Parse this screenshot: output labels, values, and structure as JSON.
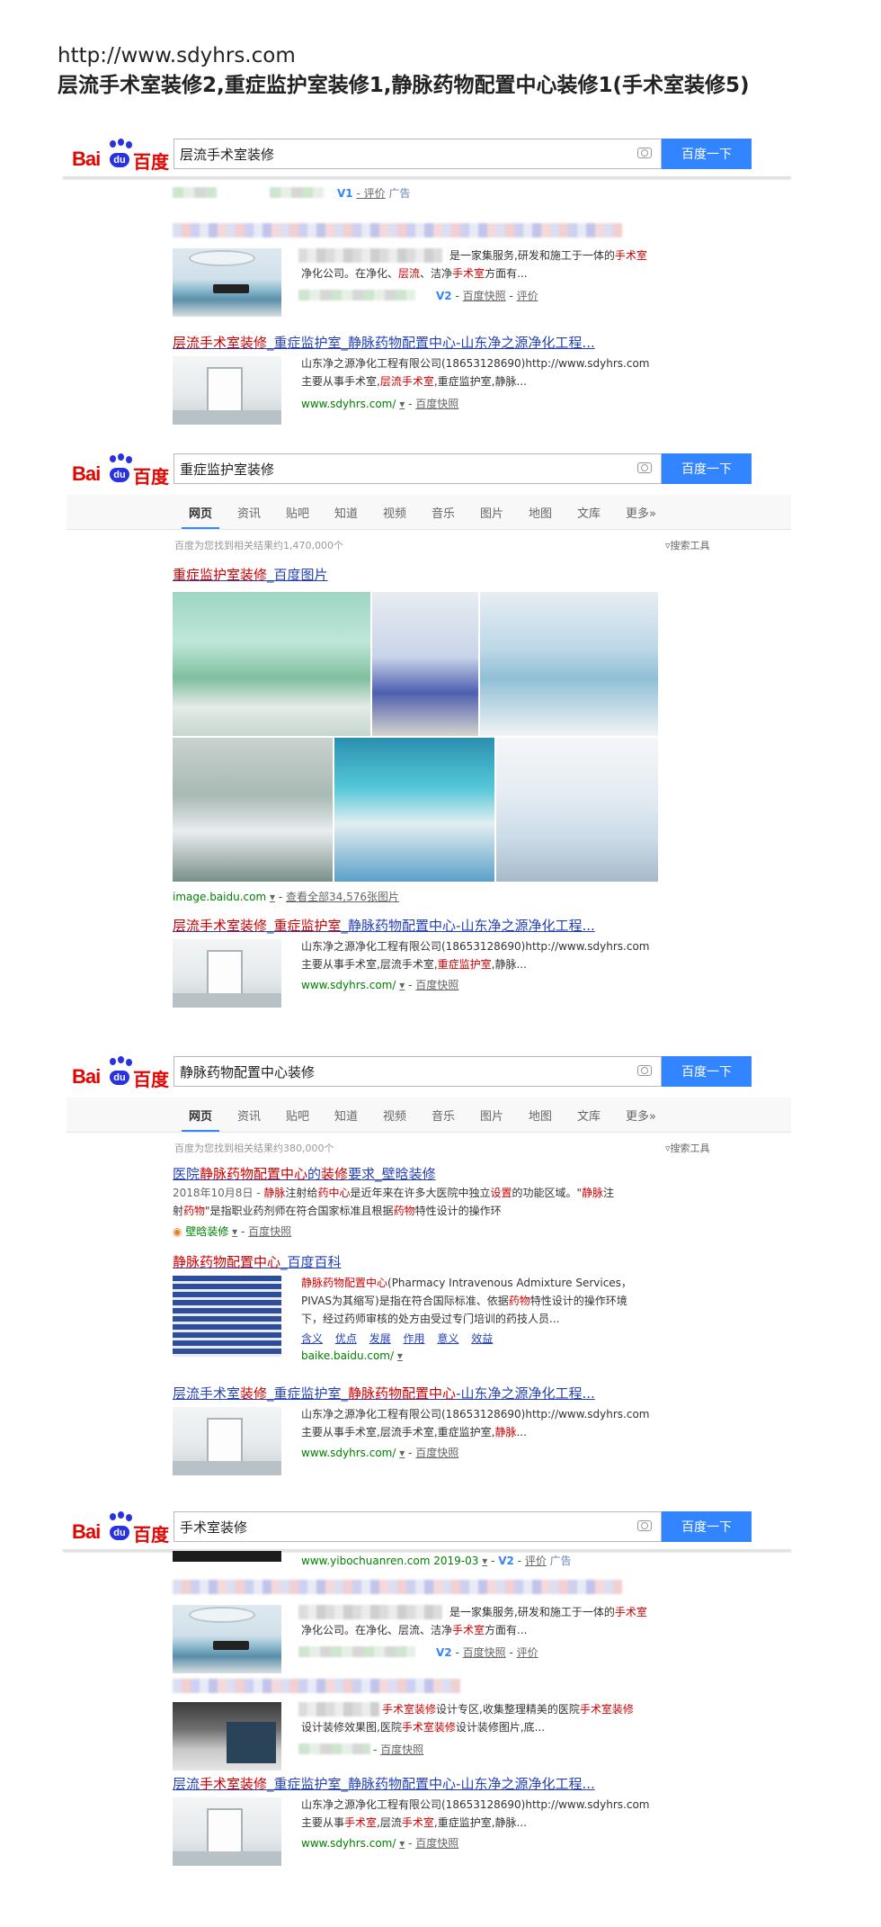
{
  "header": {
    "url": "http://www.sdyhrs.com",
    "title": "层流手术室装修2,重症监护室装修1,静脉药物配置中心装修1(手术室装修5)"
  },
  "common": {
    "logo_bai": "Bai",
    "logo_du": "du",
    "logo_cn": "百度",
    "search_button": "百度一下",
    "colors": {
      "accent": "#3385ff",
      "link": "#2440b3",
      "highlight": "#cc0000",
      "green": "#008000",
      "logo_red": "#e10601"
    }
  },
  "tabs": [
    "网页",
    "资讯",
    "贴吧",
    "知道",
    "视频",
    "音乐",
    "图片",
    "地图",
    "文库",
    "更多»"
  ],
  "search_tools": "搜索工具",
  "panel1": {
    "query": "层流手术室装修",
    "ad_links": {
      "rating": "评价",
      "ad": "广告",
      "v": "V1"
    },
    "r2": {
      "snip1": "是一家集服务,研发和施工于一体的",
      "snip1_em": "手术室",
      "snip2a": "净化公司。在净化、",
      "snip2_em1": "层流",
      "snip2b": "、洁净",
      "snip2_em2": "手术室",
      "snip2c": "方面有...",
      "v": "V2",
      "kuaizhao": "百度快照",
      "rating": "评价"
    },
    "r3": {
      "title_em1": "层流手术室装修",
      "title_mid": "_重症监护室_静脉药物配置中心-山东净之源净化工程...",
      "line1": "山东净之源净化工程有限公司(18653128690)http://www.sdyhrs.com",
      "line2a": "主要从事手术室,",
      "line2_em": "层流手术室",
      "line2b": ",重症监护室,静脉...",
      "url": "www.sdyhrs.com/",
      "kuaizhao": "百度快照"
    }
  },
  "panel2": {
    "query": "重症监护室装修",
    "stats": "百度为您找到相关结果约1,470,000个",
    "img_title_em": "重症监护室装修",
    "img_title_rest": "_百度图片",
    "img_source": "image.baidu.com",
    "img_all": "查看全部34,576张图片",
    "r2": {
      "title_em1": "层流手术室装修",
      "title_mid": "_",
      "title_em2": "重症监护室",
      "title_rest": "_静脉药物配置中心-山东净之源净化工程...",
      "line1": "山东净之源净化工程有限公司(18653128690)http://www.sdyhrs.com",
      "line2a": "主要从事手术室,层流手术室,",
      "line2_em": "重症监护室",
      "line2b": ",静脉...",
      "url": "www.sdyhrs.com/",
      "kuaizhao": "百度快照"
    }
  },
  "panel3": {
    "query": "静脉药物配置中心装修",
    "stats": "百度为您找到相关结果约380,000个",
    "r1": {
      "title_a": "医院",
      "title_em1": "静脉药物配置中心",
      "title_b": "的",
      "title_em2": "装修",
      "title_c": "要求_壁晗装修",
      "date": "2018年10月8日 - ",
      "s1_em1": "静脉",
      "s1a": "注射给",
      "s1_em2": "药中心",
      "s1b": "是近年来在许多大医院中独立",
      "s1_em3": "设置",
      "s1c": "的功能区域。\"",
      "s1_em4": "静脉",
      "s1d": "注",
      "s2a": "射",
      "s2_em1": "药物",
      "s2b": "\"是指职业药剂师在符合国家标准且根据",
      "s2_em2": "药物",
      "s2c": "特性设计的操作环",
      "source": "壁晗装修",
      "kuaizhao": "百度快照"
    },
    "r2": {
      "title_em": "静脉药物配置中心",
      "title_rest": "_百度百科",
      "s1_em": "静脉药物配置中心",
      "s1": "(Pharmacy Intravenous Admixture Services，",
      "s2a": "PIVAS为其缩写)是指在符合国际标准、依据",
      "s2_em": "药物",
      "s2b": "特性设计的操作环境",
      "s3": "下，经过药师审核的处方由受过专门培训的药技人员...",
      "links": [
        "含义",
        "优点",
        "发展",
        "作用",
        "意义",
        "效益"
      ],
      "url": "baike.baidu.com/"
    },
    "r3": {
      "title_a": "层流手术室",
      "title_em1": "装修",
      "title_b": "_重症监护室_",
      "title_em2": "静脉药物配置中心",
      "title_c": "-山东净之源净化工程...",
      "line1": "山东净之源净化工程有限公司(18653128690)http://www.sdyhrs.com",
      "line2a": "主要从事手术室,层流手术室,重症监护室,",
      "line2_em": "静脉",
      "line2b": "...",
      "url": "www.sdyhrs.com/",
      "kuaizhao": "百度快照"
    }
  },
  "panel4": {
    "query": "手术室装修",
    "ad": {
      "url": "www.yibochuanren.com",
      "date": "2019-03",
      "v": "V2",
      "rating": "评价",
      "ad": "广告"
    },
    "r2": {
      "snip1": "是一家集服务,研发和施工于一体的",
      "snip1_em": "手术室",
      "snip2a": "净化公司。在净化、层流、洁净",
      "snip2_em": "手术室",
      "snip2b": "方面有...",
      "v": "V2",
      "kuaizhao": "百度快照",
      "rating": "评价"
    },
    "r3": {
      "s1_em1": "手术室装修",
      "s1a": "设计专区,收集整理精美的医院",
      "s1_em2": "手术室装修",
      "s2a": "设计装修效果图,医院",
      "s2_em": "手术室装修",
      "s2b": "设计装修图片,底...",
      "kuaizhao": "百度快照"
    },
    "r4": {
      "title_a": "层流",
      "title_em1": "手术室装修",
      "title_b": "_重症监护室_静脉药物配置中心-山东净之源净化工程...",
      "line1": "山东净之源净化工程有限公司(18653128690)http://www.sdyhrs.com",
      "line2a": "主要从事",
      "line2_em1": "手术室",
      "line2b": ",层流",
      "line2_em2": "手术室",
      "line2c": ",重症监护室,静脉...",
      "url": "www.sdyhrs.com/",
      "kuaizhao": "百度快照"
    }
  }
}
